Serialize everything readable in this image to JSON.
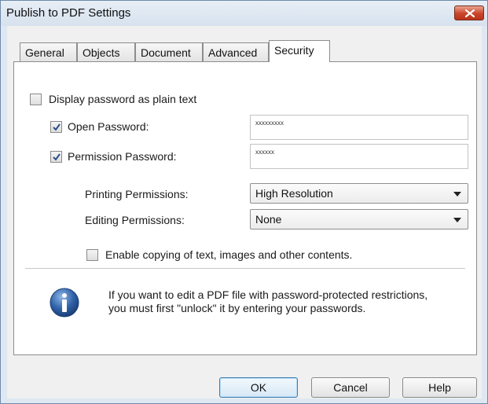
{
  "window": {
    "title": "Publish to PDF Settings"
  },
  "tabs": [
    {
      "label": "General"
    },
    {
      "label": "Objects"
    },
    {
      "label": "Document"
    },
    {
      "label": "Advanced"
    },
    {
      "label": "Security",
      "active": true
    }
  ],
  "security": {
    "plain_text_label": "Display password as plain text",
    "plain_text_checked": false,
    "open_password": {
      "label": "Open Password:",
      "checked": true,
      "value": "xxxxxxxxx"
    },
    "permission_password": {
      "label": "Permission Password:",
      "checked": true,
      "value": "xxxxxx"
    },
    "printing": {
      "label": "Printing Permissions:",
      "selected": "High Resolution"
    },
    "editing": {
      "label": "Editing Permissions:",
      "selected": "None"
    },
    "copy_label": "Enable copying of text, images and other contents.",
    "copy_checked": false,
    "info_line1": "If you want to edit a PDF file with password-protected restrictions,",
    "info_line2": "you must first \"unlock\" it by entering your passwords."
  },
  "buttons": {
    "ok": "OK",
    "cancel": "Cancel",
    "help": "Help"
  },
  "colors": {
    "accent": "#3c7fb1",
    "info_icon": "#2f62a8",
    "close": "#c9442a"
  },
  "icons": [
    "close-icon",
    "checkmark-icon",
    "chevron-down-icon",
    "info-icon"
  ]
}
